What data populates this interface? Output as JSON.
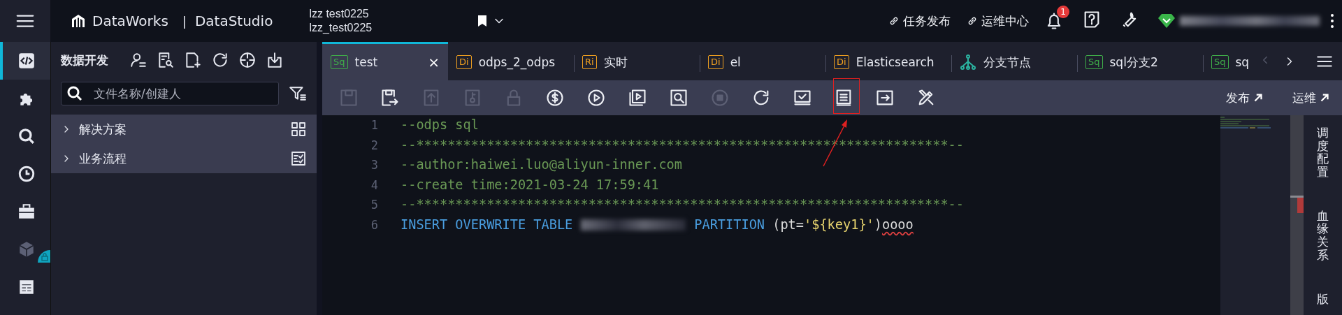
{
  "topbar": {
    "product": "DataWorks",
    "separator": "|",
    "module": "DataStudio",
    "workspace": [
      "lzz test0225",
      "lzz_test0225"
    ],
    "links": [
      {
        "label": "任务发布"
      },
      {
        "label": "运维中心"
      }
    ],
    "notifications": {
      "count": "1"
    }
  },
  "rail": {
    "items": [
      {
        "kind": "code",
        "selected": true
      },
      {
        "kind": "puzzle",
        "selected": false
      },
      {
        "kind": "search",
        "selected": false
      },
      {
        "kind": "clock",
        "selected": false
      },
      {
        "kind": "briefcase",
        "selected": false
      },
      {
        "kind": "cube",
        "selected": false
      },
      {
        "kind": "table",
        "selected": false
      }
    ]
  },
  "sidebar": {
    "title": "数据开发",
    "tools": [
      {
        "kind": "person-list"
      },
      {
        "kind": "doc-search"
      },
      {
        "kind": "file-plus"
      },
      {
        "kind": "refresh"
      },
      {
        "kind": "crosshair"
      },
      {
        "kind": "import"
      }
    ],
    "search": {
      "placeholder": "文件名称/创建人"
    },
    "items": [
      {
        "label": "解决方案",
        "expanded": false,
        "kind": "grid"
      },
      {
        "label": "业务流程",
        "expanded": false,
        "kind": "checklist"
      }
    ]
  },
  "tabs": [
    {
      "kind": "badge",
      "badge": "Sq",
      "color": "#3fae49",
      "label": "test",
      "selected": true,
      "close": "×"
    },
    {
      "kind": "badge",
      "badge": "Di",
      "color": "#f0a020",
      "label": "odps_2_odps",
      "selected": false
    },
    {
      "kind": "badge",
      "badge": "Ri",
      "color": "#f0a020",
      "label": "实时",
      "selected": false
    },
    {
      "kind": "badge",
      "badge": "Di",
      "color": "#f0a020",
      "label": "el",
      "selected": false
    },
    {
      "kind": "badge",
      "badge": "Di",
      "color": "#f0a020",
      "label": "Elasticsearch",
      "selected": false
    },
    {
      "kind": "branch",
      "color": "#2bb3a0",
      "label": "分支节点",
      "selected": false
    },
    {
      "kind": "badge",
      "badge": "Sq",
      "color": "#3fae49",
      "label": "sql分支2",
      "selected": false
    },
    {
      "kind": "badge",
      "badge": "Sq",
      "color": "#3fae49",
      "label": "sq",
      "selected": false
    }
  ],
  "toolbar": {
    "items": [
      {
        "kind": "save",
        "disabled": true
      },
      {
        "kind": "save-as",
        "disabled": false
      },
      {
        "kind": "submit",
        "disabled": true
      },
      {
        "kind": "key",
        "disabled": true
      },
      {
        "kind": "lock",
        "disabled": true
      },
      {
        "kind": "dollar",
        "disabled": false
      },
      {
        "kind": "play",
        "disabled": false
      },
      {
        "kind": "play-params",
        "disabled": false
      },
      {
        "kind": "preview",
        "disabled": false
      },
      {
        "kind": "stop",
        "disabled": true
      },
      {
        "kind": "refresh",
        "disabled": false
      },
      {
        "kind": "check",
        "disabled": false
      },
      {
        "kind": "format",
        "disabled": false
      },
      {
        "kind": "exit",
        "disabled": false
      },
      {
        "kind": "tool",
        "disabled": false
      }
    ],
    "links": [
      {
        "label": "发布"
      },
      {
        "label": "运维"
      }
    ]
  },
  "editor": {
    "lines": [
      {
        "number": "1",
        "tokens": [
          {
            "kind": "comment",
            "text": "--odps sql"
          }
        ]
      },
      {
        "number": "2",
        "tokens": [
          {
            "kind": "comment",
            "text": "--********************************************************************--"
          }
        ]
      },
      {
        "number": "3",
        "tokens": [
          {
            "kind": "comment",
            "text": "--author:haiwei.luo@aliyun-inner.com"
          }
        ]
      },
      {
        "number": "4",
        "tokens": [
          {
            "kind": "comment",
            "text": "--create time:2021-03-24 17:59:41"
          }
        ]
      },
      {
        "number": "5",
        "tokens": [
          {
            "kind": "comment",
            "text": "--********************************************************************--"
          }
        ]
      },
      {
        "number": "6",
        "tokens": [
          {
            "kind": "keyword",
            "text": "INSERT OVERWRITE TABLE"
          },
          {
            "kind": "redacted"
          },
          {
            "kind": "keyword",
            "text": "PARTITION"
          },
          {
            "kind": "plain",
            "text": " (pt="
          },
          {
            "kind": "string",
            "text": "'${key1}'"
          },
          {
            "kind": "plain",
            "text": ")"
          },
          {
            "kind": "error",
            "text": "oooo"
          }
        ]
      }
    ]
  },
  "right_panel": {
    "items": [
      {
        "label": "调度配置"
      },
      {
        "label": "血缘关系"
      },
      {
        "label": "版"
      }
    ]
  }
}
